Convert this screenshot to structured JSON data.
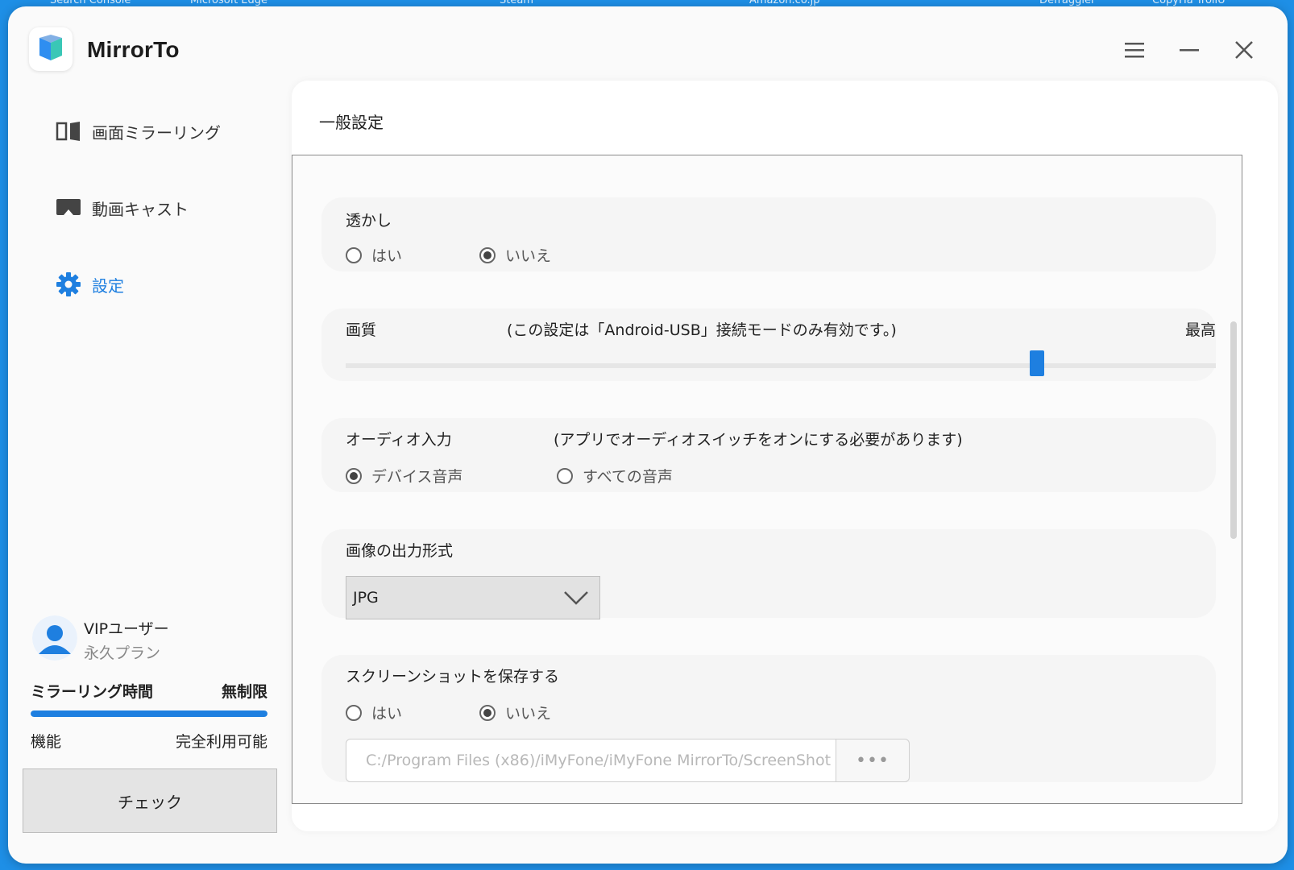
{
  "desktop": {
    "labels": [
      "Search Console",
      "Microsoft Edge",
      "Steam",
      "Amazon.co.jp",
      "Defraggler",
      "CopyHa TrollU"
    ]
  },
  "app": {
    "title": "MirrorTo",
    "brand_color": "#1e7fe0",
    "window_controls": {
      "menu": "menu-icon",
      "minimize": "minimize-icon",
      "close": "close-icon"
    }
  },
  "sidebar": {
    "items": [
      {
        "label": "画面ミラーリング",
        "icon": "screen-mirror-icon",
        "active": false
      },
      {
        "label": "動画キャスト",
        "icon": "video-cast-icon",
        "active": false
      },
      {
        "label": "設定",
        "icon": "gear-icon",
        "active": true
      }
    ],
    "user": {
      "name": "VIPユーザー",
      "plan": "永久プラン",
      "mirror_time_label": "ミラーリング時間",
      "mirror_time_value": "無制限",
      "mirror_progress": 1.0,
      "features_label": "機能",
      "features_value": "完全利用可能",
      "check_button": "チェック"
    }
  },
  "main": {
    "section_title": "一般設定",
    "watermark": {
      "label": "透かし",
      "options": [
        "はい",
        "いいえ"
      ],
      "selected": "いいえ"
    },
    "quality": {
      "label": "画質",
      "note": "(この設定は「Android-USB」接続モードのみ有効です。)",
      "max_label": "最高",
      "level_fraction": 0.794
    },
    "audio": {
      "label": "オーディオ入力",
      "note": "(アプリでオーディオスイッチをオンにする必要があります)",
      "options": [
        "デバイス音声",
        "すべての音声"
      ],
      "selected": "デバイス音声"
    },
    "image_format": {
      "label": "画像の出力形式",
      "value": "JPG"
    },
    "screenshot": {
      "label": "スクリーンショットを保存する",
      "options": [
        "はい",
        "いいえ"
      ],
      "selected": "いいえ",
      "path_placeholder": "C:/Program Files (x86)/iMyFone/iMyFone MirrorTo/ScreenShot",
      "browse_label": "•••"
    }
  }
}
